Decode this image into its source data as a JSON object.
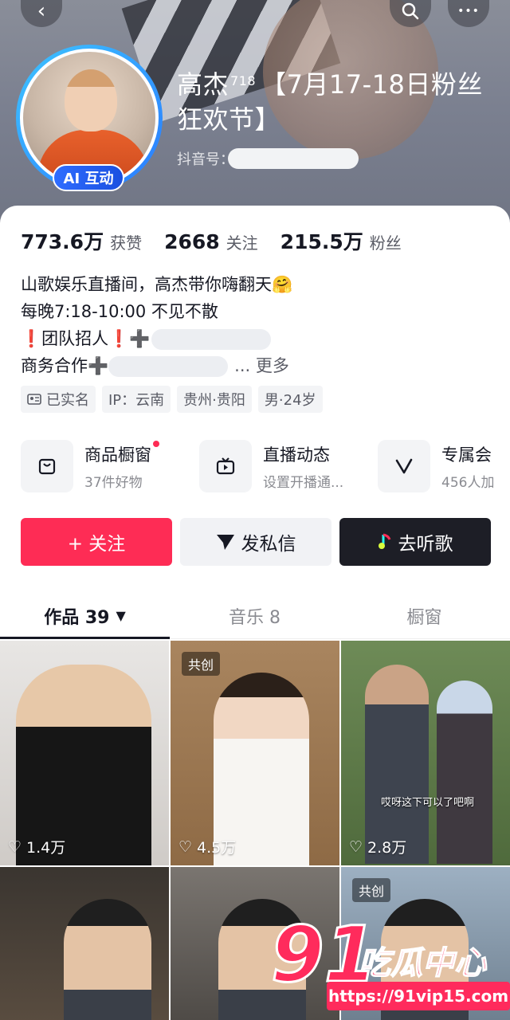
{
  "header": {
    "back_icon": "‹",
    "search_icon": "⌕",
    "more_icon": "•••",
    "ai_badge": "AI 互动",
    "nickname_main": "高杰",
    "nickname_sup": "718",
    "nickname_rest": "【7月17-18日粉丝狂欢节】",
    "douyin_id_label": "抖音号："
  },
  "stats": [
    {
      "value": "773.6万",
      "label": "获赞"
    },
    {
      "value": "2668",
      "label": "关注"
    },
    {
      "value": "215.5万",
      "label": "粉丝"
    }
  ],
  "bio": {
    "line1": "山歌娱乐直播间，高杰带你嗨翻天🤗",
    "line2": "每晚7:18-10:00 不见不散",
    "line3_prefix": "❗团队招人❗➕",
    "line4_prefix": "商务合作➕",
    "line4_more": "... 更多"
  },
  "tags": [
    {
      "icon": "id-card-icon",
      "label": "已实名"
    },
    {
      "label": "IP：云南"
    },
    {
      "label": "贵州·贵阳"
    },
    {
      "label": "男·24岁"
    }
  ],
  "features": [
    {
      "icon": "bag-icon",
      "title": "商品橱窗",
      "sub": "37件好物",
      "dot": true
    },
    {
      "icon": "tv-icon",
      "title": "直播动态",
      "sub": "设置开播通..."
    },
    {
      "icon": "v-icon",
      "title": "专属会",
      "sub": "456人加"
    }
  ],
  "actions": {
    "follow": "+ 关注",
    "message": "发私信",
    "listen": "去听歌"
  },
  "tabs": [
    {
      "label": "作品 39",
      "active": true
    },
    {
      "label": "音乐 8"
    },
    {
      "label": "橱窗"
    }
  ],
  "videos": [
    {
      "likes": "1.4万"
    },
    {
      "likes": "4.5万",
      "chip": "共创"
    },
    {
      "likes": "2.8万",
      "subtitle": "哎呀这下可以了吧啊"
    },
    {},
    {},
    {
      "chip": "共创"
    }
  ],
  "watermark": {
    "number": "91",
    "text": "吃瓜中心",
    "url": "https://91vip15.com"
  },
  "colors": {
    "accent": "#fe2c55",
    "dark_button": "#1d1e26",
    "ai_badge": "#2f6dff"
  }
}
